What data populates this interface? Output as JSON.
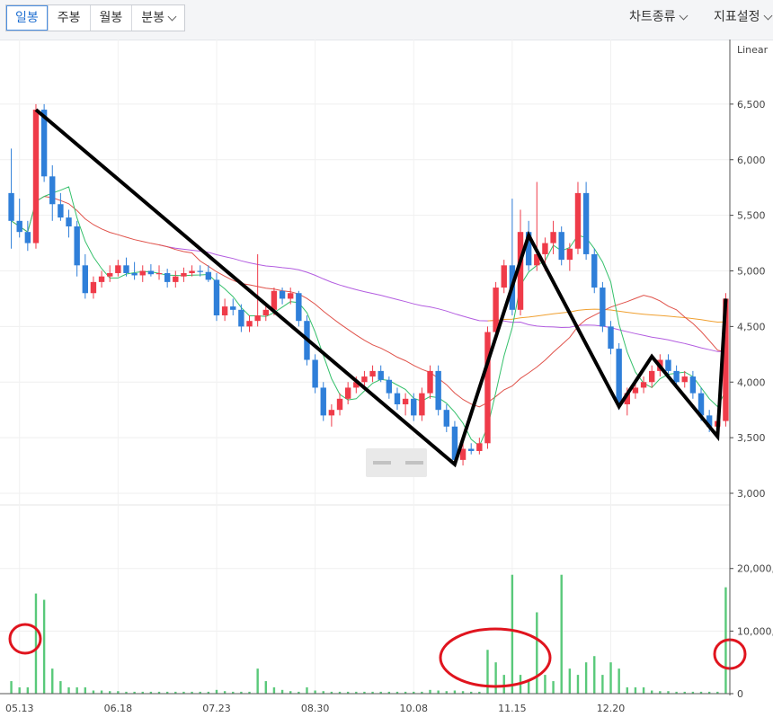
{
  "toolbar": {
    "periods": [
      "일봉",
      "주봉",
      "월봉",
      "분봉"
    ],
    "active_period": "일봉",
    "chart_type_label": "차트종류",
    "indicator_label": "지표설정"
  },
  "chart_data": [
    {
      "type": "candlestick",
      "scale_label": "Linear",
      "ylim": [
        3000,
        7000
      ],
      "y_ticks": [
        "6,500",
        "6,000",
        "5,500",
        "5,000",
        "4,500",
        "4,000",
        "3,500",
        "3,000"
      ],
      "x_ticks": [
        "05.13",
        "06.18",
        "07.23",
        "08.30",
        "10.08",
        "11.15",
        "12.20"
      ],
      "colors": {
        "up": "#ef3b49",
        "down": "#2f7fd9",
        "ma5": "#35c06b",
        "ma20": "#e0524a",
        "ma60": "#b35de0",
        "ma120": "#f0a030",
        "trendline": "#000000",
        "volume": "#59c97a",
        "circle": "#e0141e"
      },
      "series": [
        {
          "name": "candles",
          "ohlc": [
            [
              5700,
              6100,
              5200,
              5450
            ],
            [
              5450,
              5650,
              5300,
              5350
            ],
            [
              5350,
              5450,
              5180,
              5250
            ],
            [
              5250,
              6500,
              5200,
              6450
            ],
            [
              6450,
              6500,
              5800,
              5850
            ],
            [
              5850,
              5950,
              5450,
              5600
            ],
            [
              5600,
              5700,
              5450,
              5480
            ],
            [
              5480,
              5550,
              5300,
              5400
            ],
            [
              5400,
              5450,
              4950,
              5050
            ],
            [
              5050,
              5150,
              4750,
              4800
            ],
            [
              4800,
              4950,
              4750,
              4900
            ],
            [
              4900,
              5000,
              4850,
              4950
            ],
            [
              4950,
              5050,
              4900,
              4980
            ],
            [
              4980,
              5100,
              4950,
              5050
            ],
            [
              5050,
              5120,
              4950,
              4980
            ],
            [
              4980,
              5080,
              4920,
              4960
            ],
            [
              4960,
              5050,
              4900,
              5000
            ],
            [
              5000,
              5060,
              4950,
              4970
            ],
            [
              4970,
              5050,
              4920,
              4980
            ],
            [
              4980,
              5020,
              4850,
              4900
            ],
            [
              4900,
              5000,
              4850,
              4950
            ],
            [
              4950,
              5030,
              4900,
              4980
            ],
            [
              4980,
              5050,
              4950,
              5000
            ],
            [
              5000,
              5050,
              4950,
              4990
            ],
            [
              4990,
              5050,
              4900,
              4920
            ],
            [
              4920,
              4980,
              4550,
              4600
            ],
            [
              4600,
              4750,
              4550,
              4680
            ],
            [
              4680,
              4750,
              4600,
              4650
            ],
            [
              4650,
              4700,
              4450,
              4500
            ],
            [
              4500,
              4600,
              4450,
              4550
            ],
            [
              4550,
              5150,
              4500,
              4600
            ],
            [
              4600,
              4700,
              4550,
              4650
            ],
            [
              4650,
              4850,
              4600,
              4820
            ],
            [
              4820,
              4850,
              4700,
              4750
            ],
            [
              4750,
              4850,
              4700,
              4800
            ],
            [
              4800,
              4820,
              4500,
              4550
            ],
            [
              4550,
              4600,
              4150,
              4200
            ],
            [
              4200,
              4250,
              3900,
              3950
            ],
            [
              3950,
              4000,
              3650,
              3700
            ],
            [
              3700,
              3800,
              3600,
              3750
            ],
            [
              3750,
              3900,
              3700,
              3850
            ],
            [
              3850,
              4000,
              3800,
              3950
            ],
            [
              3950,
              4050,
              3900,
              4000
            ],
            [
              4000,
              4100,
              3950,
              4050
            ],
            [
              4050,
              4150,
              4000,
              4100
            ],
            [
              4100,
              4150,
              4000,
              4020
            ],
            [
              4020,
              4050,
              3850,
              3900
            ],
            [
              3900,
              3950,
              3750,
              3800
            ],
            [
              3800,
              3900,
              3700,
              3850
            ],
            [
              3850,
              3900,
              3650,
              3700
            ],
            [
              3700,
              3950,
              3650,
              3900
            ],
            [
              3900,
              4150,
              3850,
              4100
            ],
            [
              4100,
              4150,
              3700,
              3750
            ],
            [
              3750,
              3800,
              3550,
              3600
            ],
            [
              3600,
              3650,
              3250,
              3300
            ],
            [
              3300,
              3450,
              3250,
              3400
            ],
            [
              3400,
              3450,
              3350,
              3380
            ],
            [
              3380,
              3500,
              3350,
              3450
            ],
            [
              3450,
              4500,
              3400,
              4450
            ],
            [
              4450,
              4900,
              4400,
              4850
            ],
            [
              4850,
              5100,
              4800,
              5050
            ],
            [
              5050,
              5650,
              4600,
              4650
            ],
            [
              4650,
              5550,
              4600,
              5350
            ],
            [
              5350,
              5450,
              5000,
              5050
            ],
            [
              5050,
              5800,
              5000,
              5150
            ],
            [
              5150,
              5300,
              5000,
              5250
            ],
            [
              5250,
              5450,
              5150,
              5350
            ],
            [
              5350,
              5400,
              5050,
              5100
            ],
            [
              5100,
              5250,
              5000,
              5200
            ],
            [
              5200,
              5800,
              5150,
              5700
            ],
            [
              5700,
              5800,
              5100,
              5150
            ],
            [
              5150,
              5200,
              4800,
              4850
            ],
            [
              4850,
              4900,
              4450,
              4500
            ],
            [
              4500,
              4550,
              4250,
              4300
            ],
            [
              4300,
              4350,
              3750,
              3800
            ],
            [
              3800,
              3950,
              3700,
              3900
            ],
            [
              3900,
              4000,
              3850,
              3950
            ],
            [
              3950,
              4050,
              3900,
              4000
            ],
            [
              4000,
              4150,
              3950,
              4100
            ],
            [
              4100,
              4250,
              4050,
              4200
            ],
            [
              4200,
              4250,
              4050,
              4100
            ],
            [
              4100,
              4150,
              3950,
              4000
            ],
            [
              4000,
              4100,
              3950,
              4050
            ],
            [
              4050,
              4100,
              3850,
              3900
            ],
            [
              3900,
              3950,
              3650,
              3700
            ],
            [
              3700,
              3750,
              3550,
              3600
            ],
            [
              3600,
              3700,
              3550,
              3650
            ],
            [
              3650,
              4800,
              3600,
              4750
            ]
          ]
        },
        {
          "name": "volume",
          "values": [
            2,
            1,
            1,
            16,
            15,
            4,
            2,
            1,
            1,
            1,
            0.5,
            0.5,
            0.4,
            0.4,
            0.3,
            0.3,
            0.3,
            0.3,
            0.3,
            0.3,
            0.3,
            0.3,
            0.3,
            0.3,
            0.3,
            0.6,
            0.4,
            0.3,
            0.3,
            0.3,
            4,
            2,
            1,
            0.6,
            0.4,
            0.3,
            1,
            0.5,
            0.4,
            0.3,
            0.3,
            0.3,
            0.3,
            0.3,
            0.3,
            0.3,
            0.3,
            0.3,
            0.3,
            0.3,
            0.3,
            0.6,
            0.5,
            0.4,
            0.5,
            0.4,
            0.3,
            0.3,
            7,
            5,
            3,
            19,
            3,
            2,
            13,
            3,
            2,
            19,
            4,
            3,
            5,
            6,
            3,
            5,
            4,
            1,
            1,
            1,
            0.5,
            0.4,
            0.4,
            0.3,
            0.3,
            0.3,
            0.3,
            0.3,
            0.3,
            17
          ]
        }
      ],
      "volume_ticks": [
        "20,000,0",
        "10,000,0",
        "0"
      ]
    }
  ]
}
